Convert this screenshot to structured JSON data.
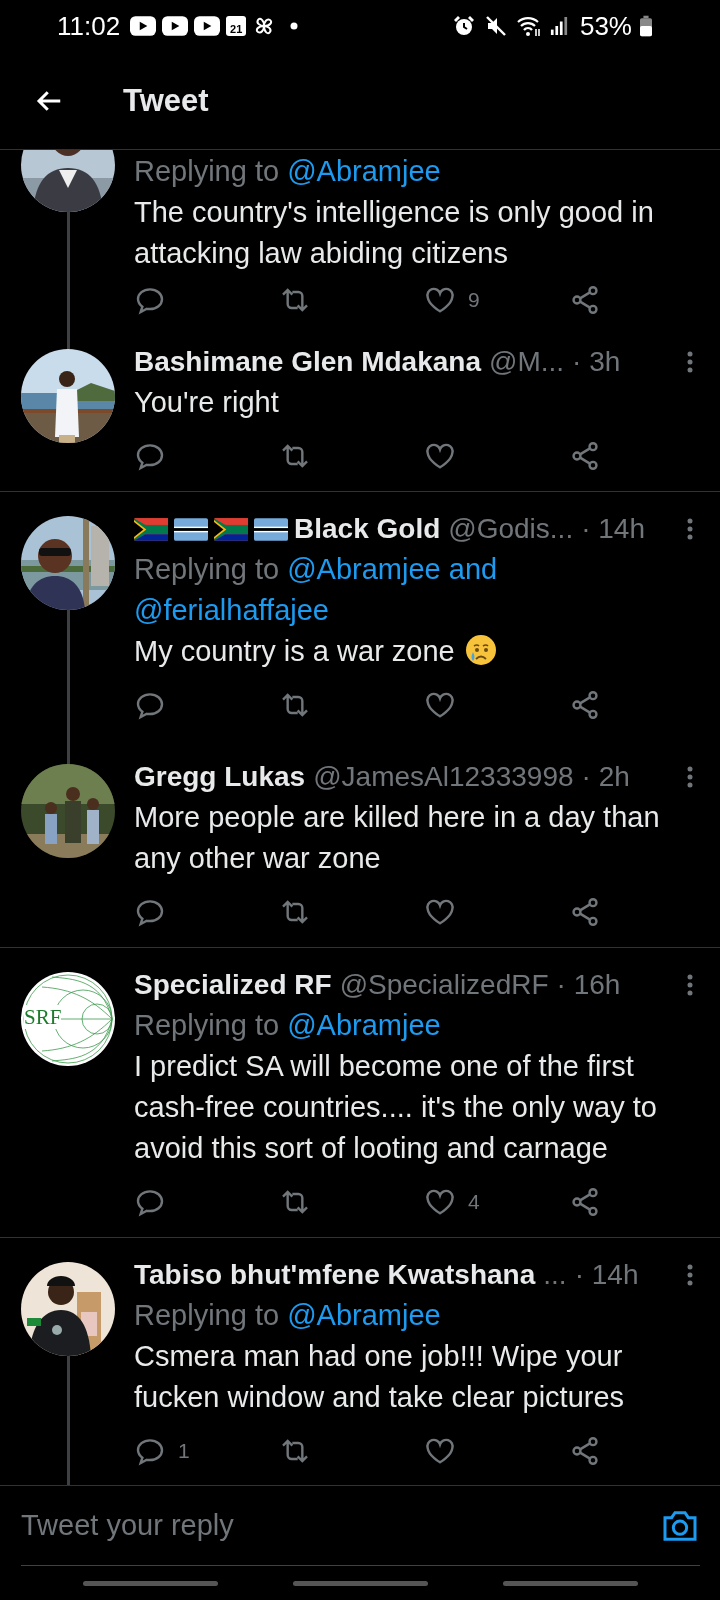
{
  "status_bar": {
    "time": "11:02",
    "calendar_day": "21",
    "battery": "53%"
  },
  "header": {
    "title": "Tweet"
  },
  "tweets": [
    {
      "avatar": {
        "kind": "picture"
      },
      "replying_label": "Replying to",
      "replying_to": [
        "@Abramjee"
      ],
      "text": "The country's intelligence is only good in attacking law abiding citizens",
      "like_count": "9",
      "thread_line": true
    },
    {
      "avatar": {
        "kind": "picture"
      },
      "name": "Bashimane Glen Mdakana",
      "handle": "@M...",
      "time": "· 3h",
      "text": "You're right",
      "thread_line": false
    },
    {
      "avatar": {
        "kind": "picture"
      },
      "flags": [
        {
          "kind": "south-africa"
        },
        {
          "kind": "botswana"
        },
        {
          "kind": "south-africa"
        },
        {
          "kind": "botswana"
        }
      ],
      "name": "Black Gold",
      "handle": "@Godis...",
      "time": "· 14h",
      "replying_label": "Replying to",
      "replying_to": [
        "@Abramjee and",
        "@ferialhaffajee"
      ],
      "text": "My country is a war zone",
      "emoji": {
        "kind": "crying-face"
      },
      "thread_line": true
    },
    {
      "avatar": {
        "kind": "picture"
      },
      "name": "Gregg Lukas",
      "handle": "@JamesAl12333998",
      "time": "· 2h",
      "text": "More people are killed here in a day than any other war zone",
      "thread_line": false
    },
    {
      "avatar": {
        "kind": "logo",
        "text": "SRF"
      },
      "name": "Specialized RF",
      "handle": "@SpecializedRF",
      "time": "· 16h",
      "replying_label": "Replying to",
      "replying_to": [
        "@Abramjee"
      ],
      "text": "I predict SA will become one of the first cash-free countries.... it's the only way to avoid this sort of looting and carnage",
      "like_count": "4",
      "thread_line": false
    },
    {
      "avatar": {
        "kind": "picture"
      },
      "name": "Tabiso bhut'mfene Kwatshana",
      "handle": "...",
      "time": "· 14h",
      "replying_label": "Replying to",
      "replying_to": [
        "@Abramjee"
      ],
      "text": "Csmera man had one job!!! Wipe your fucken window and take clear pictures",
      "reply_count": "1",
      "thread_line": true
    }
  ],
  "reply_box": {
    "placeholder": "Tweet your reply"
  }
}
